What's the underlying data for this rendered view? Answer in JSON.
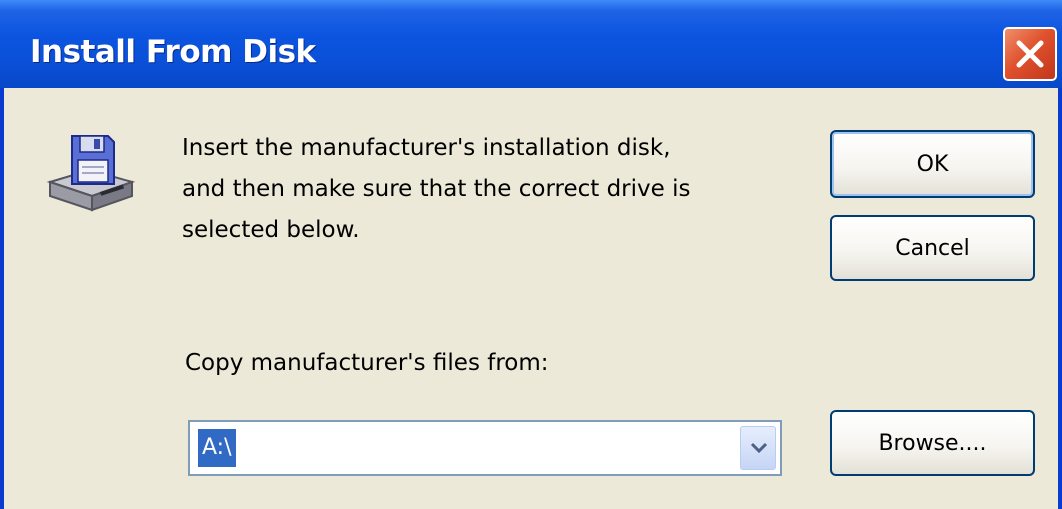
{
  "window": {
    "title": "Install From Disk"
  },
  "message": {
    "line1": "Insert the manufacturer's installation disk,",
    "line2": "and then make sure that the correct drive is",
    "line3": "selected below."
  },
  "buttons": {
    "ok_label": "OK",
    "cancel_label": "Cancel",
    "browse_label": "Browse...."
  },
  "copy_from": {
    "label": "Copy manufacturer's files from:",
    "value": "A:\\"
  },
  "icons": {
    "close": "close-icon",
    "disk": "floppy-disk-drive-icon",
    "dropdown": "chevron-down-icon"
  },
  "colors": {
    "titlebar": "#0a4fd6",
    "close_button": "#e0522d",
    "dialog_background": "#ece9d8",
    "selection": "#316ac5"
  }
}
